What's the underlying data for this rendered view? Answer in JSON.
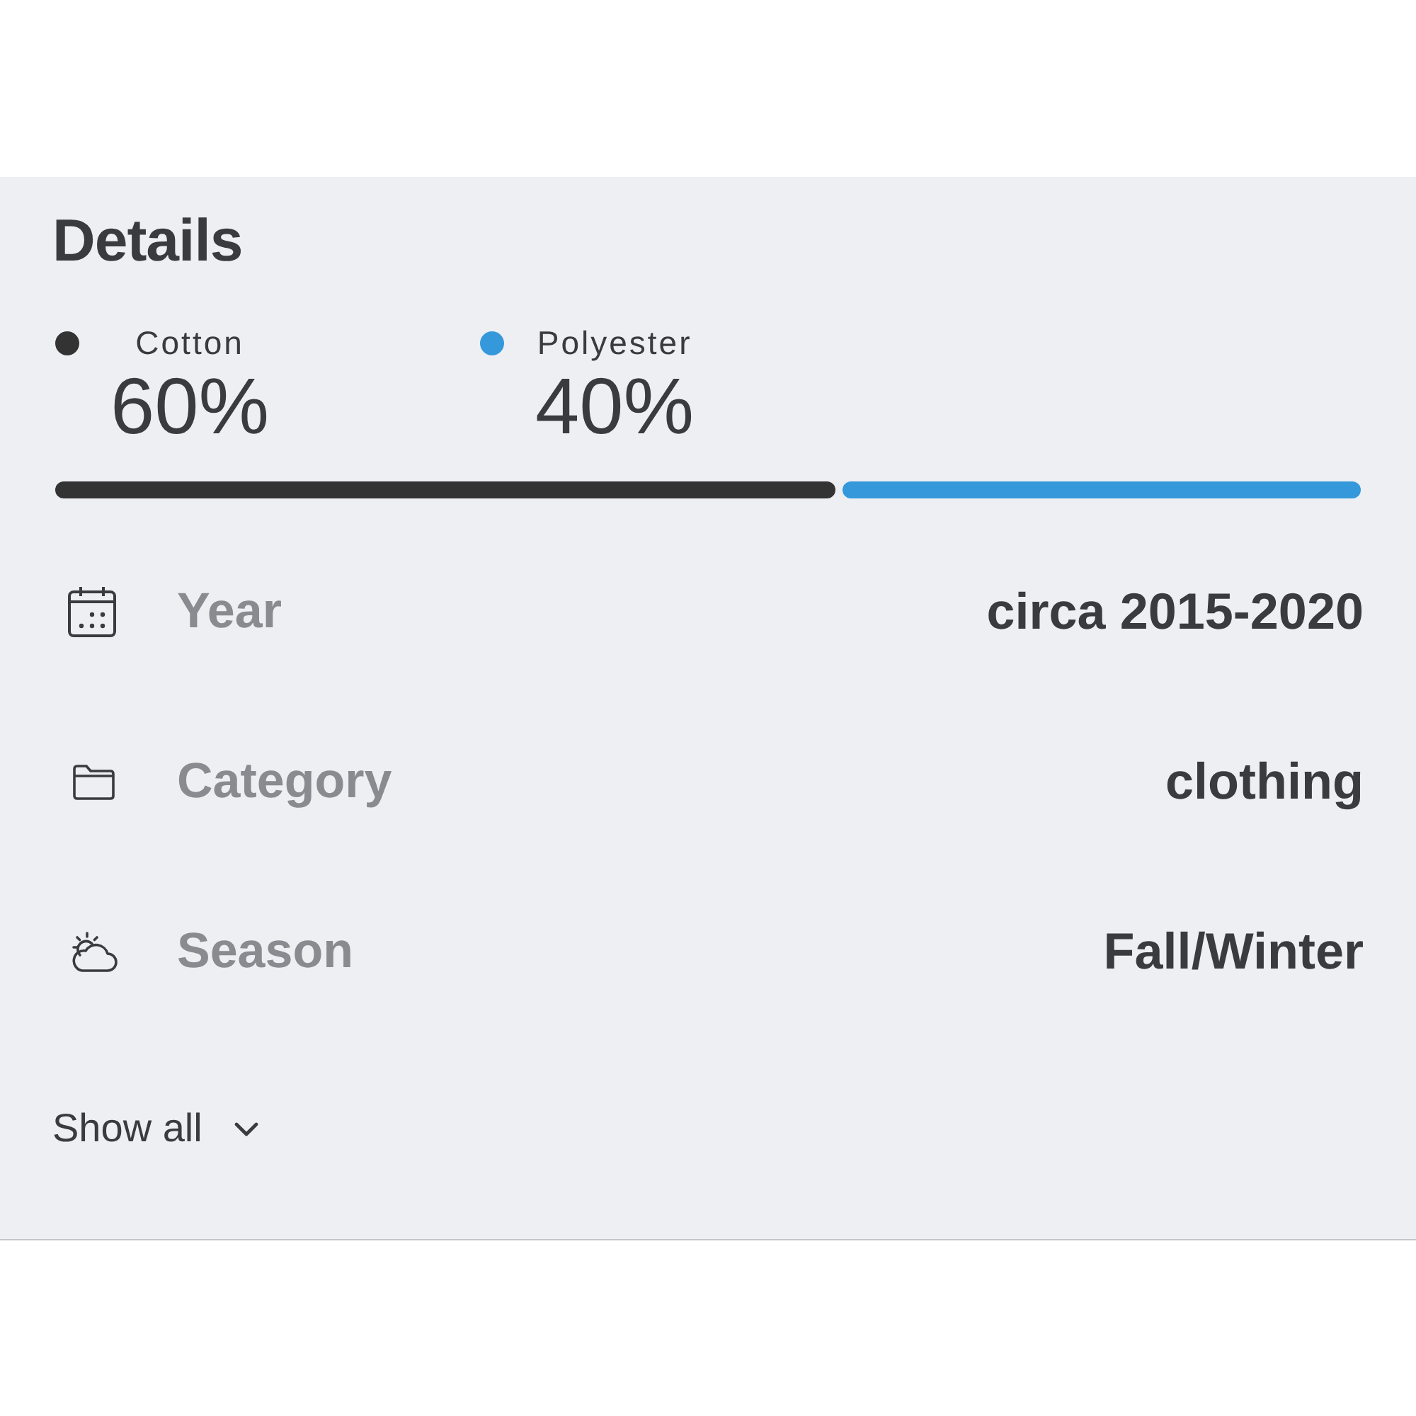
{
  "section": {
    "title": "Details"
  },
  "materials": [
    {
      "name": "Cotton",
      "percent": "60%",
      "color": "#333333",
      "level": 0.6
    },
    {
      "name": "Polyester",
      "percent": "40%",
      "color": "#3498db",
      "level": 0.4
    }
  ],
  "details": [
    {
      "kind": "date",
      "label": "Year",
      "value": "circa 2015-2020"
    },
    {
      "kind": "category",
      "label": "Category",
      "value": "clothing"
    },
    {
      "kind": "season",
      "label": "Season",
      "value": "Fall/Winter"
    }
  ],
  "show_all": {
    "label": "Show all"
  }
}
